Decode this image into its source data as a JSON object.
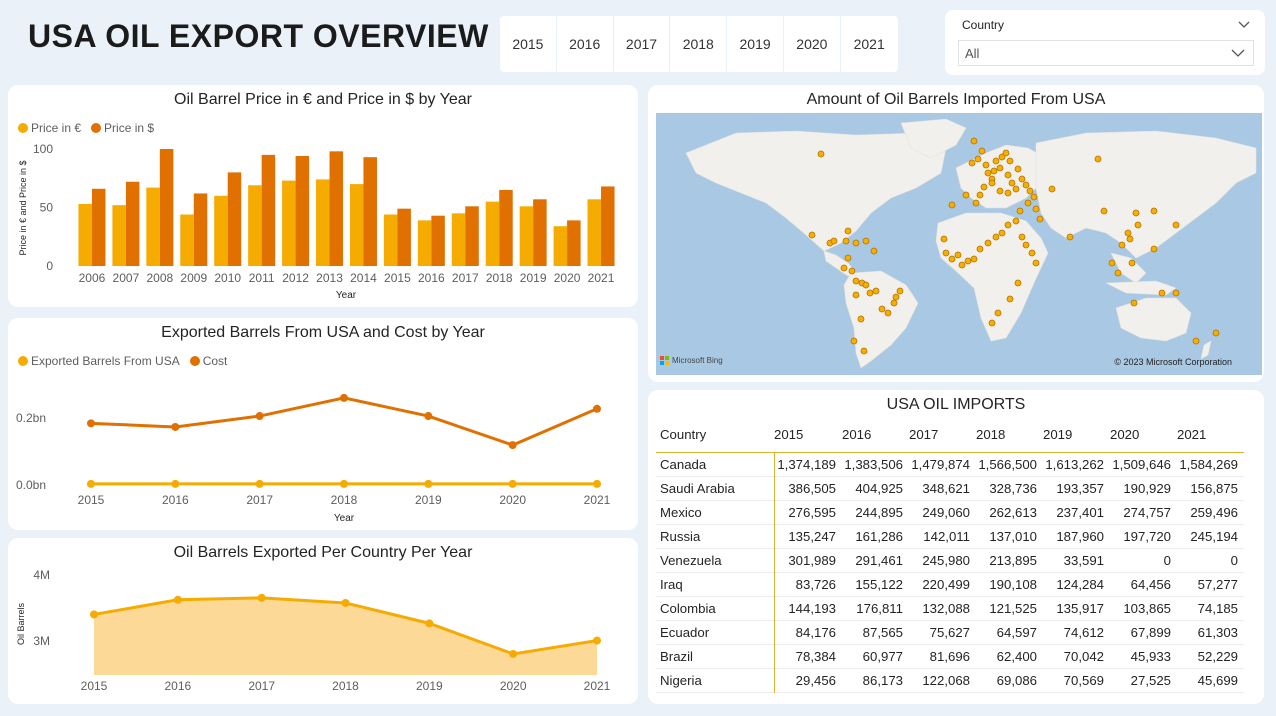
{
  "page_title": "USA OIL EXPORT OVERVIEW",
  "year_slicer": [
    "2015",
    "2016",
    "2017",
    "2018",
    "2019",
    "2020",
    "2021"
  ],
  "country_filter": {
    "label": "Country",
    "value": "All"
  },
  "colors": {
    "primary": "#f6ab00",
    "secondary": "#e07000",
    "area_fill": "#fdd998",
    "bg": "#eaf1f8"
  },
  "chart1": {
    "title": "Oil Barrel Price in € and Price in $ by Year",
    "legend": [
      "Price in €",
      "Price in $"
    ],
    "ylabel": "Price in € and Price in $",
    "xlabel": "Year",
    "yticks": [
      "100",
      "50",
      "0"
    ]
  },
  "chart2": {
    "title": "Exported Barrels From USA and Cost by Year",
    "legend": [
      "Exported Barrels From USA",
      "Cost"
    ],
    "xlabel": "Year",
    "yticks": [
      "0.2bn",
      "0.0bn"
    ]
  },
  "chart3": {
    "title": "Oil Barrels Exported Per Country Per Year",
    "ylabel": "Oil Barrels",
    "yticks": [
      "4M",
      "3M"
    ]
  },
  "map": {
    "title": "Amount of Oil Barrels Imported From USA",
    "copyright": "© 2023 Microsoft Corporation",
    "provider": "Microsoft Bing"
  },
  "table": {
    "title": "USA OIL IMPORTS",
    "headers": [
      "Country",
      "2015",
      "2016",
      "2017",
      "2018",
      "2019",
      "2020",
      "2021"
    ],
    "rows": [
      [
        "Canada",
        "1,374,189",
        "1,383,506",
        "1,479,874",
        "1,566,500",
        "1,613,262",
        "1,509,646",
        "1,584,269"
      ],
      [
        "Saudi Arabia",
        "386,505",
        "404,925",
        "348,621",
        "328,736",
        "193,357",
        "190,929",
        "156,875"
      ],
      [
        "Mexico",
        "276,595",
        "244,895",
        "249,060",
        "262,613",
        "237,401",
        "274,757",
        "259,496"
      ],
      [
        "Russia",
        "135,247",
        "161,286",
        "142,011",
        "137,010",
        "187,960",
        "197,720",
        "245,194"
      ],
      [
        "Venezuela",
        "301,989",
        "291,461",
        "245,980",
        "213,895",
        "33,591",
        "0",
        "0"
      ],
      [
        "Iraq",
        "83,726",
        "155,122",
        "220,499",
        "190,108",
        "124,284",
        "64,456",
        "57,277"
      ],
      [
        "Colombia",
        "144,193",
        "176,811",
        "132,088",
        "121,525",
        "135,917",
        "103,865",
        "74,185"
      ],
      [
        "Ecuador",
        "84,176",
        "87,565",
        "75,627",
        "64,597",
        "74,612",
        "67,899",
        "61,303"
      ],
      [
        "Brazil",
        "78,384",
        "60,977",
        "81,696",
        "62,400",
        "70,042",
        "45,933",
        "52,229"
      ],
      [
        "Nigeria",
        "29,456",
        "86,173",
        "122,068",
        "69,086",
        "70,569",
        "27,525",
        "45,699"
      ]
    ]
  },
  "chart_data": [
    {
      "type": "bar",
      "title": "Oil Barrel Price in € and Price in $ by Year",
      "xlabel": "Year",
      "ylabel": "Price in € and Price in $",
      "ylim": [
        0,
        100
      ],
      "categories": [
        "2006",
        "2007",
        "2008",
        "2009",
        "2010",
        "2011",
        "2012",
        "2013",
        "2014",
        "2015",
        "2016",
        "2017",
        "2018",
        "2019",
        "2020",
        "2021"
      ],
      "series": [
        {
          "name": "Price in €",
          "values": [
            53,
            52,
            67,
            44,
            60,
            69,
            73,
            74,
            70,
            44,
            39,
            45,
            55,
            51,
            34,
            57
          ]
        },
        {
          "name": "Price in $",
          "values": [
            66,
            72,
            100,
            62,
            80,
            95,
            94,
            98,
            93,
            49,
            43,
            51,
            65,
            57,
            39,
            68
          ]
        }
      ]
    },
    {
      "type": "line",
      "title": "Exported Barrels From USA and Cost by Year",
      "xlabel": "Year",
      "ylim": [
        0,
        0.35
      ],
      "x": [
        "2015",
        "2016",
        "2017",
        "2018",
        "2019",
        "2020",
        "2021"
      ],
      "series": [
        {
          "name": "Exported Barrels From USA",
          "values": [
            0.003,
            0.003,
            0.003,
            0.003,
            0.003,
            0.003,
            0.003
          ]
        },
        {
          "name": "Cost",
          "values": [
            0.17,
            0.16,
            0.19,
            0.24,
            0.19,
            0.11,
            0.21
          ]
        }
      ]
    },
    {
      "type": "area",
      "title": "Oil Barrels Exported Per Country Per Year",
      "ylabel": "Oil Barrels",
      "ylim": [
        2.5,
        4.1
      ],
      "x": [
        "2015",
        "2016",
        "2017",
        "2018",
        "2019",
        "2020",
        "2021"
      ],
      "values": [
        3.45,
        3.68,
        3.71,
        3.63,
        3.31,
        2.83,
        3.04
      ]
    }
  ]
}
